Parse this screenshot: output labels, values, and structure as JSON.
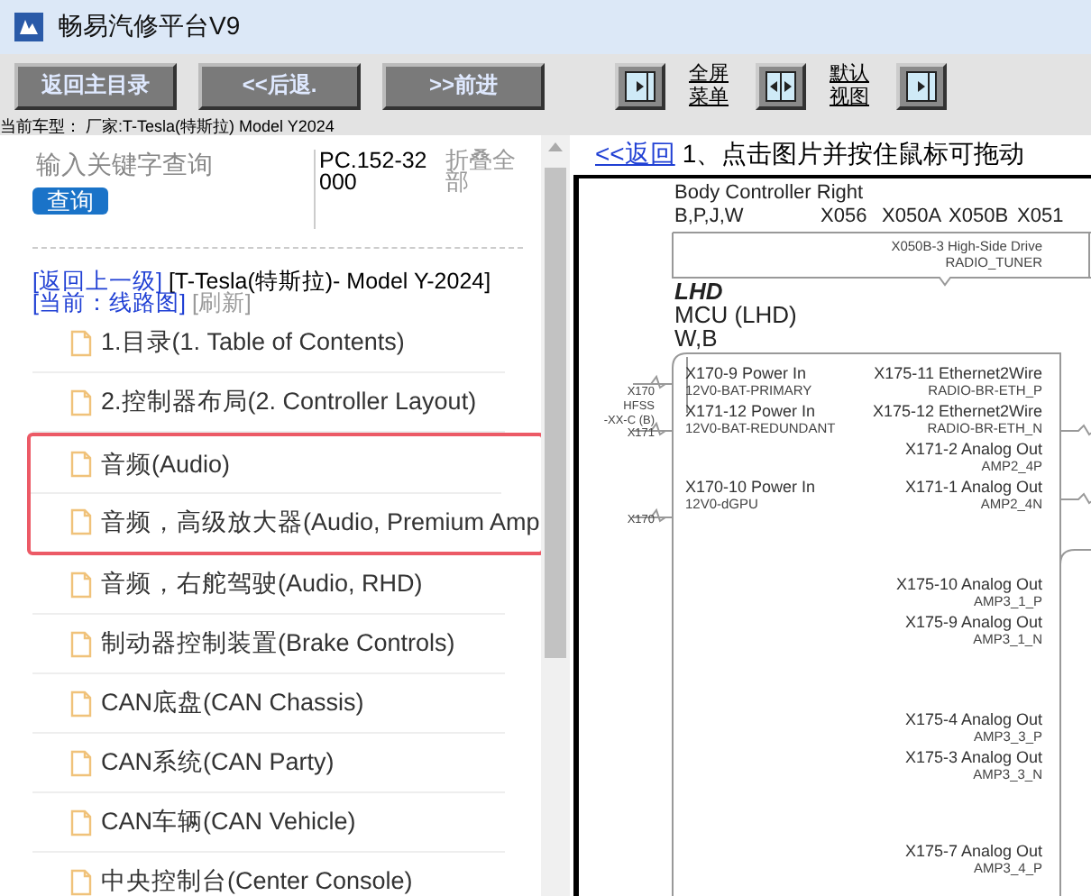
{
  "window": {
    "title": "畅易汽修平台V9"
  },
  "toolbar": {
    "buttons": [
      "返回主目录",
      "<<后退.",
      ">>前进"
    ],
    "view_controls": [
      {
        "kind": "toggle"
      },
      {
        "kind": "link",
        "label": "全屏菜单"
      },
      {
        "kind": "toggle"
      },
      {
        "kind": "link",
        "label": "默认视图"
      },
      {
        "kind": "toggle"
      }
    ]
  },
  "vehicle_bar": "当前车型： 厂家:T-Tesla(特斯拉) Model Y2024",
  "left_panel": {
    "search": {
      "placeholder": "输入关键字查询",
      "button": "查询"
    },
    "part_number": "PC.152-32000",
    "collapse_all": "折叠全部",
    "breadcrumb": {
      "back": "[返回上一级]",
      "path": "[T-Tesla(特斯拉)- Model Y-2024]",
      "current": "[当前：线路图]",
      "refresh": "[刷新]"
    },
    "items": [
      {
        "label": "1.目录(1. Table of Contents)",
        "highlighted": false
      },
      {
        "label": "2.控制器布局(2. Controller Layout)",
        "highlighted": false
      },
      {
        "label": "音频(Audio)",
        "highlighted": true
      },
      {
        "label": "音频，高级放大器(Audio, Premium Amp",
        "highlighted": true
      },
      {
        "label": "音频，右舵驾驶(Audio, RHD)",
        "highlighted": false
      },
      {
        "label": "制动器控制装置(Brake Controls)",
        "highlighted": false
      },
      {
        "label": "CAN底盘(CAN Chassis)",
        "highlighted": false
      },
      {
        "label": "CAN系统(CAN Party)",
        "highlighted": false
      },
      {
        "label": "CAN车辆(CAN Vehicle)",
        "highlighted": false
      },
      {
        "label": "中央控制台(Center Console)",
        "highlighted": false
      }
    ]
  },
  "right_panel": {
    "back_link": "<<返回",
    "instruction": "1、点击图片并按住鼠标可拖动",
    "diagram": {
      "title": "Body Controller Right",
      "codes": "B,P,J,W",
      "connectors": [
        "X056",
        "X050A",
        "X050B",
        "X051"
      ],
      "tuner_pin": {
        "name": "X050B-3 High-Side Drive",
        "signal": "RADIO_TUNER"
      },
      "variant": "LHD",
      "module": "MCU (LHD)",
      "module_codes": "W,B",
      "side_labels": [
        "X170",
        "HFSS",
        "-XX-C (B)",
        "X171",
        "X170"
      ],
      "left_pins": [
        {
          "name": "X170-9 Power In",
          "signal": "12V0-BAT-PRIMARY"
        },
        {
          "name": "X171-12 Power In",
          "signal": "12V0-BAT-REDUNDANT"
        },
        {
          "name": "X170-10 Power In",
          "signal": "12V0-dGPU"
        }
      ],
      "right_pins": [
        {
          "name": "X175-11 Ethernet2Wire",
          "signal": "RADIO-BR-ETH_P"
        },
        {
          "name": "X175-12 Ethernet2Wire",
          "signal": "RADIO-BR-ETH_N"
        },
        {
          "name": "X171-2 Analog Out",
          "signal": "AMP2_4P"
        },
        {
          "name": "X171-1 Analog Out",
          "signal": "AMP2_4N"
        },
        {
          "name": "X175-10 Analog Out",
          "signal": "AMP3_1_P"
        },
        {
          "name": "X175-9 Analog Out",
          "signal": "AMP3_1_N"
        },
        {
          "name": "X175-4 Analog Out",
          "signal": "AMP3_3_P"
        },
        {
          "name": "X175-3 Analog Out",
          "signal": "AMP3_3_N"
        },
        {
          "name": "X175-7 Analog Out",
          "signal": "AMP3_4_P"
        }
      ]
    }
  }
}
